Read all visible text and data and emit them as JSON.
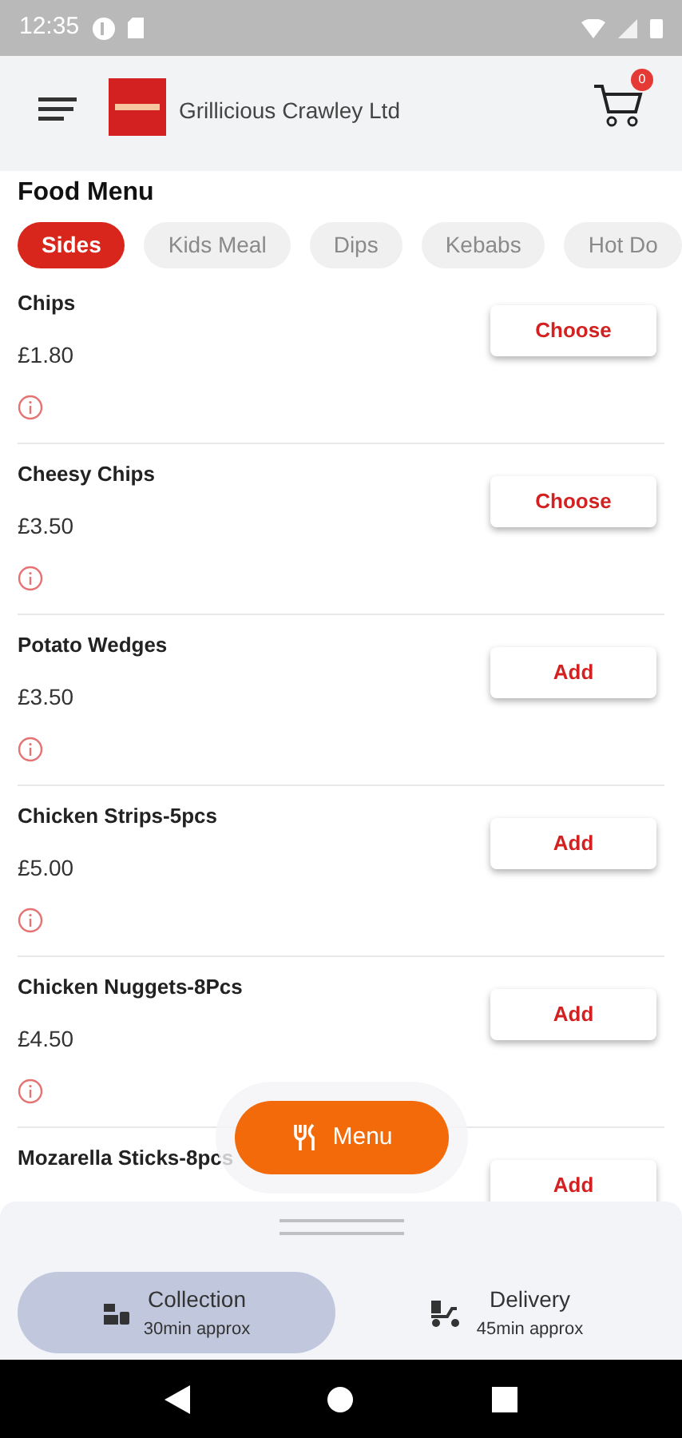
{
  "status_bar": {
    "time": "12:35"
  },
  "header": {
    "store_name": "Grillicious Crawley Ltd",
    "cart_count": "0"
  },
  "section_title": "Food Menu",
  "categories": [
    {
      "label": "Sides",
      "selected": true
    },
    {
      "label": "Kids Meal",
      "selected": false
    },
    {
      "label": "Dips",
      "selected": false
    },
    {
      "label": "Kebabs",
      "selected": false
    },
    {
      "label": "Hot Do",
      "selected": false
    }
  ],
  "items": [
    {
      "name": "Chips",
      "price": "£1.80",
      "action": "Choose"
    },
    {
      "name": "Cheesy Chips",
      "price": "£3.50",
      "action": "Choose"
    },
    {
      "name": "Potato Wedges",
      "price": "£3.50",
      "action": "Add"
    },
    {
      "name": "Chicken Strips-5pcs",
      "price": "£5.00",
      "action": "Add"
    },
    {
      "name": "Chicken Nuggets-8Pcs",
      "price": "£4.50",
      "action": "Add"
    },
    {
      "name": "Mozarella Sticks-8pcs",
      "action": "Add"
    }
  ],
  "menu_button": "Menu",
  "order_modes": [
    {
      "label": "Collection",
      "time": "30min approx",
      "selected": true,
      "kind": "collection"
    },
    {
      "label": "Delivery",
      "time": "45min approx",
      "selected": false,
      "kind": "delivery"
    }
  ]
}
